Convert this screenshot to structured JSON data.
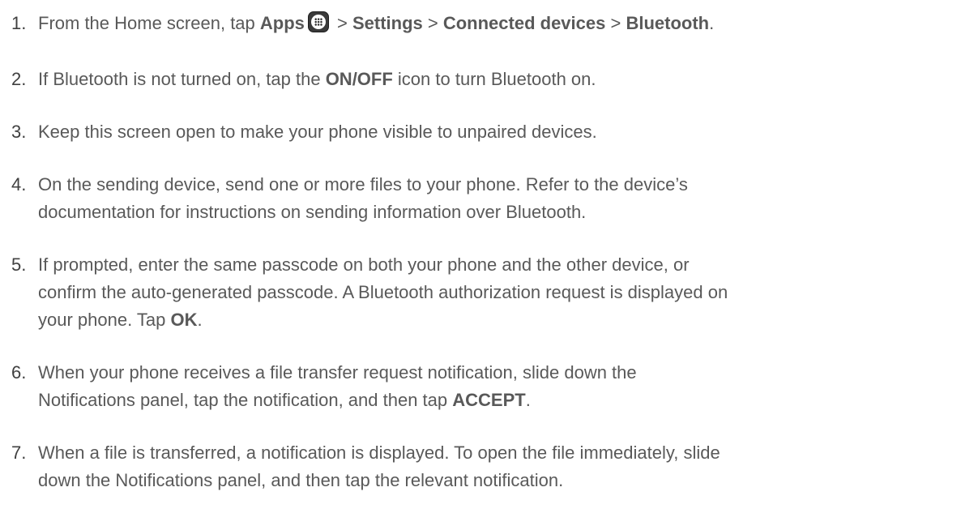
{
  "steps": [
    {
      "number": "1.",
      "parts": {
        "t1": "From the Home screen, tap ",
        "b1": "Apps",
        "t2": " > ",
        "b2": "Settings",
        "t3": " > ",
        "b3": "Connected devices",
        "t4": " > ",
        "b4": "Bluetooth",
        "t5": "."
      },
      "icon": "apps-grid-icon"
    },
    {
      "number": "2.",
      "parts": {
        "t1": "If Bluetooth is not turned on, tap the ",
        "b1": "ON/OFF",
        "t2": " icon to turn Bluetooth on."
      }
    },
    {
      "number": "3.",
      "text": "Keep this screen open to make your phone visible to unpaired devices."
    },
    {
      "number": "4.",
      "lines": [
        "On the sending device, send one or more files to your phone. Refer to the device’s",
        "documentation for instructions on sending information over Bluetooth."
      ]
    },
    {
      "number": "5.",
      "lines": [
        "If prompted, enter the same passcode on both your phone and the other device, or",
        "confirm the auto-generated passcode. A Bluetooth authorization request is displayed on"
      ],
      "last": {
        "t1": "your phone. Tap ",
        "b1": "OK",
        "t2": "."
      }
    },
    {
      "number": "6.",
      "lines": [
        "When your phone receives a file transfer request notification, slide down the"
      ],
      "last": {
        "t1": "Notifications panel, tap the notification, and then tap ",
        "b1": "ACCEPT",
        "t2": "."
      }
    },
    {
      "number": "7.",
      "lines": [
        "When a file is transferred, a notification is displayed. To open the file immediately, slide",
        "down the Notifications panel, and then tap the relevant notification."
      ]
    }
  ]
}
